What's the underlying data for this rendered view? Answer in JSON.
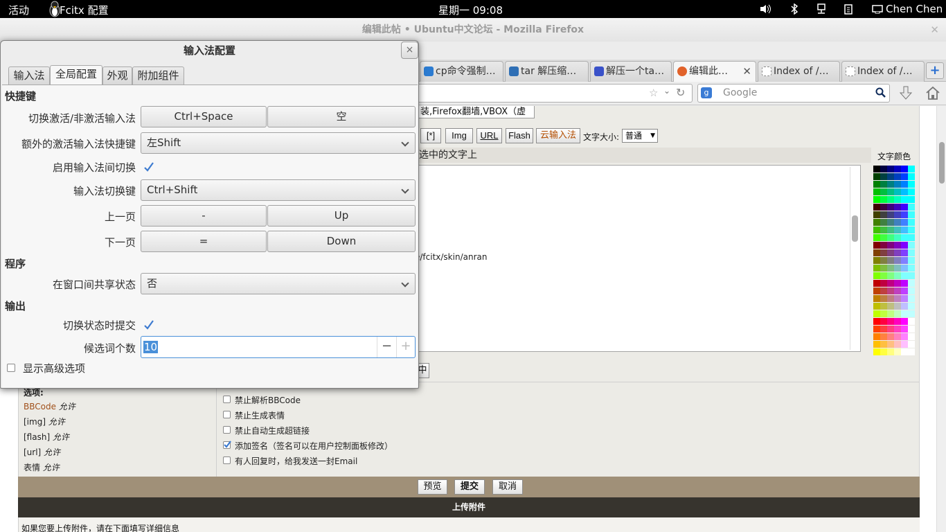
{
  "topbar": {
    "activities": "活动",
    "app": "Fcitx 配置",
    "clock": "星期一 09:08",
    "user": "Chen Chen"
  },
  "firefox": {
    "title": "编辑此帖 • Ubuntu中文论坛  -  Mozilla Firefox",
    "tabs": [
      {
        "label": "cp命令强制…",
        "color": "#2b7bd1"
      },
      {
        "label": "tar 解压缩…",
        "color": "#2f6fb5"
      },
      {
        "label": "解压一个ta…",
        "color": "#3a52c9"
      },
      {
        "label": "编辑此…",
        "color": "#e1622a"
      },
      {
        "label": "Index of /…",
        "color": "#ffffff"
      },
      {
        "label": "Index of /…",
        "color": "#ffffff"
      }
    ],
    "new_tab": "+",
    "search_placeholder": "Google"
  },
  "forum": {
    "subject_value": "装,Firefox翻墙,VBOX（虚",
    "toolbar": [
      "[*]",
      "Img",
      "URL",
      "Flash",
      "云输入法"
    ],
    "font_size_label": "文字大小:",
    "font_size_value": "普通",
    "hint": "选中的文字上",
    "color_label": "文字颜色",
    "editor_text": "e/fcitx/skin/anran",
    "fragment_btn": "中",
    "options_title": "选项:",
    "options_left": [
      {
        "name": "BBCode",
        "state": "允许"
      },
      {
        "name": "[img]",
        "state": "允许"
      },
      {
        "name": "[flash]",
        "state": "允许"
      },
      {
        "name": "[url]",
        "state": "允许"
      },
      {
        "name": "表情",
        "state": "允许"
      }
    ],
    "options_right": [
      {
        "label": "禁止解析BBCode",
        "checked": false
      },
      {
        "label": "禁止生成表情",
        "checked": false
      },
      {
        "label": "禁止自动生成超链接",
        "checked": false
      },
      {
        "label": "添加签名（签名可以在用户控制面板修改）",
        "checked": true
      },
      {
        "label": "有人回复时，给我发送一封Email",
        "checked": false
      }
    ],
    "buttons": {
      "preview": "预览",
      "submit": "提交",
      "cancel": "取消"
    },
    "upload_title": "上传附件",
    "upload_hint": "如果您要上传附件，请在下面填写详细信息"
  },
  "dialog": {
    "title": "输入法配置",
    "close": "×",
    "tabs": [
      "输入法",
      "全局配置",
      "外观",
      "附加组件"
    ],
    "section_hotkey": "快捷键",
    "toggle_label": "切换激活/非激活输入法",
    "toggle_key1": "Ctrl+Space",
    "toggle_key2": "空",
    "extra_label": "额外的激活输入法快捷键",
    "extra_value": "左Shift",
    "enable_switch_label": "启用输入法间切换",
    "switch_key_label": "输入法切换键",
    "switch_key_value": "Ctrl+Shift",
    "prev_label": "上一页",
    "prev_key1": "-",
    "prev_key2": "Up",
    "next_label": "下一页",
    "next_key1": "=",
    "next_key2": "Down",
    "section_program": "程序",
    "share_label": "在窗口间共享状态",
    "share_value": "否",
    "section_output": "输出",
    "commit_label": "切换状态时提交",
    "candidate_label": "候选词个数",
    "candidate_value": "10",
    "advanced_label": "显示高级选项"
  }
}
